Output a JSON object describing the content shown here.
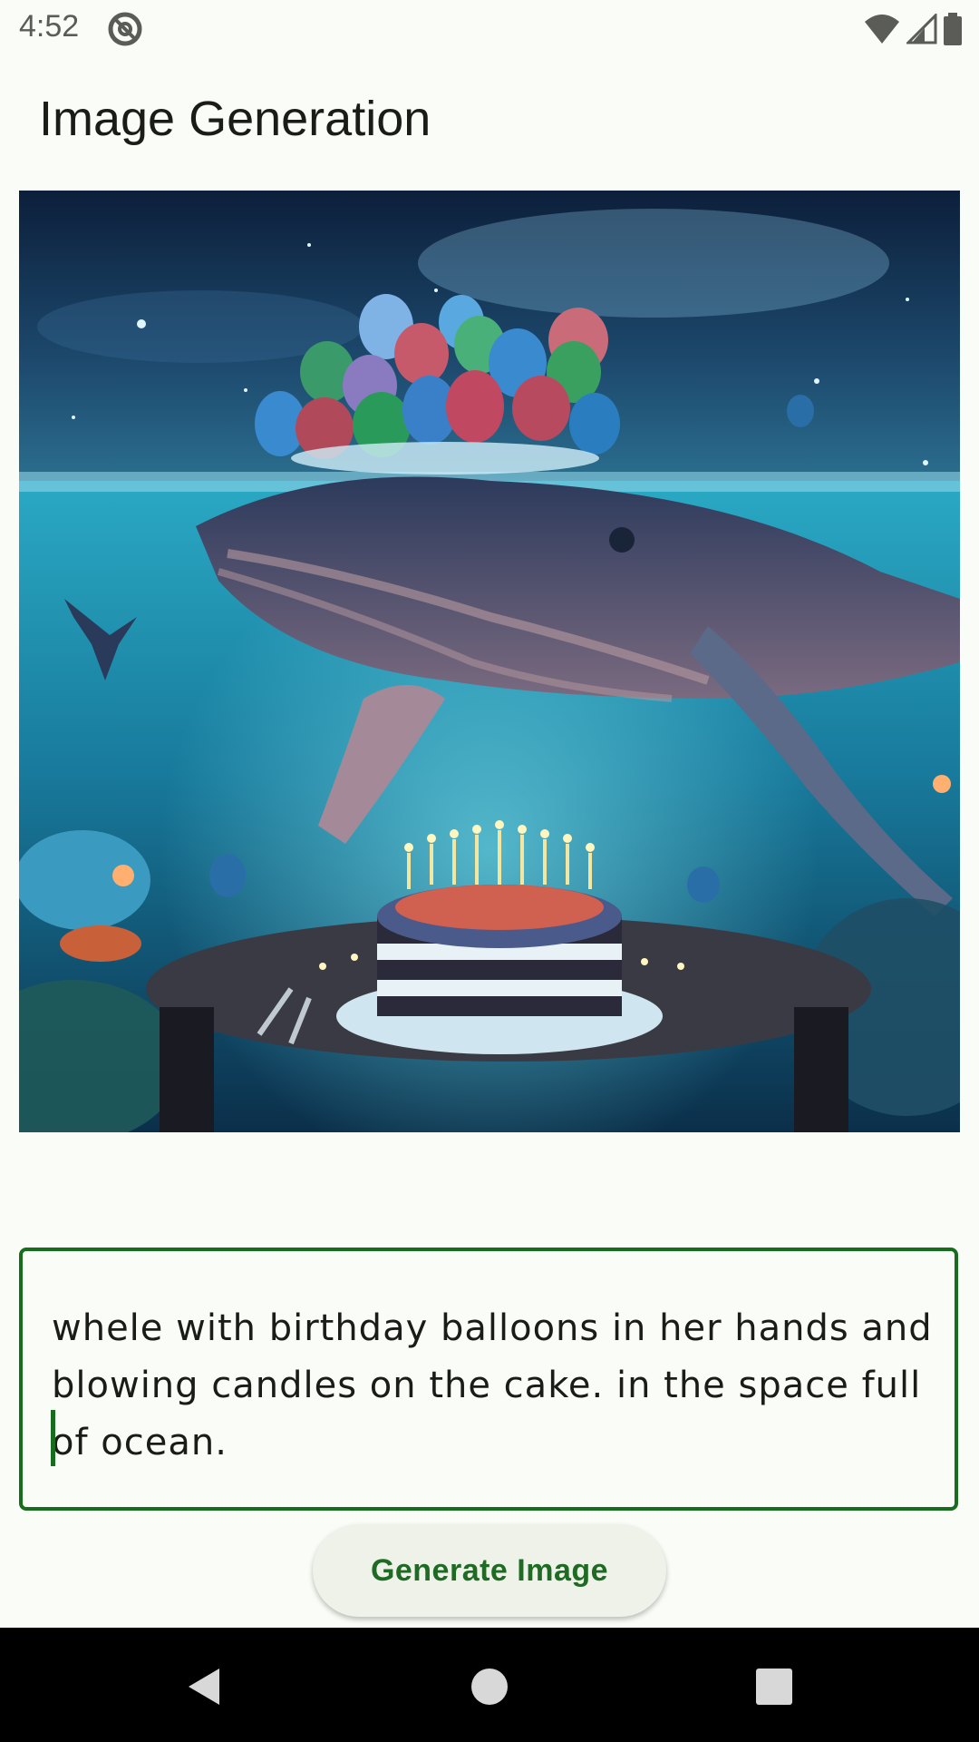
{
  "status_bar": {
    "time": "4:52",
    "icons": [
      "do-not-disturb-icon",
      "wifi-icon",
      "cell-signal-icon",
      "battery-icon"
    ]
  },
  "header": {
    "title": "Image Generation"
  },
  "image": {
    "alt": "whale with birthday balloons and a cake underwater in space"
  },
  "prompt": {
    "value": "whele with birthday balloons in her hands and blowing candles on the cake. in the space full of ocean."
  },
  "actions": {
    "generate_label": "Generate Image"
  },
  "nav_bar": {
    "icons": [
      "back-icon",
      "home-icon",
      "recents-icon"
    ]
  },
  "colors": {
    "accent": "#186c1e",
    "background": "#fafcf7",
    "button_bg": "#eef2e9"
  }
}
